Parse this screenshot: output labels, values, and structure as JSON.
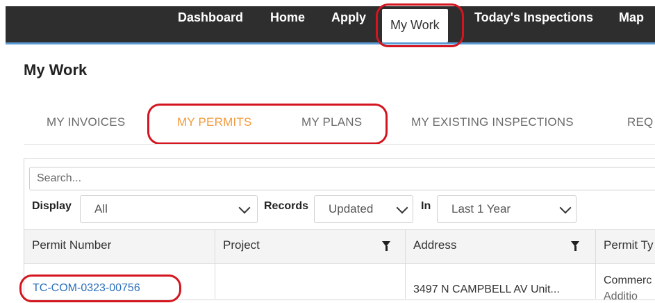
{
  "nav": {
    "items": [
      {
        "label": "Dashboard",
        "active": false
      },
      {
        "label": "Home",
        "active": false
      },
      {
        "label": "Apply",
        "active": false
      },
      {
        "label": "My Work",
        "active": true
      },
      {
        "label": "Today's Inspections",
        "active": false
      },
      {
        "label": "Map",
        "active": false
      }
    ]
  },
  "page": {
    "title": "My Work"
  },
  "tabs": [
    {
      "label": "MY INVOICES",
      "active": false
    },
    {
      "label": "MY PERMITS",
      "active": true
    },
    {
      "label": "MY PLANS",
      "active": false
    },
    {
      "label": "MY EXISTING INSPECTIONS",
      "active": false
    },
    {
      "label": "REQ",
      "active": false
    }
  ],
  "filters": {
    "search_placeholder": "Search...",
    "display_label": "Display",
    "display_value": "All",
    "records_label": "Records",
    "records_value": "Updated",
    "in_label": "In",
    "in_value": "Last 1 Year"
  },
  "table": {
    "columns": [
      "Permit Number",
      "Project",
      "Address",
      "Permit Ty"
    ],
    "rows": [
      {
        "permit_number": "TC-COM-0323-00756",
        "project": "",
        "address": "3497 N CAMPBELL AV Unit...",
        "permit_type_line1": "Commerc",
        "permit_type_line2": "Additio"
      }
    ]
  },
  "colors": {
    "accent_orange": "#f29a3b",
    "nav_bg": "#2e2e2e",
    "link_blue": "#2a6ebb",
    "highlight_red": "#d4151f"
  }
}
